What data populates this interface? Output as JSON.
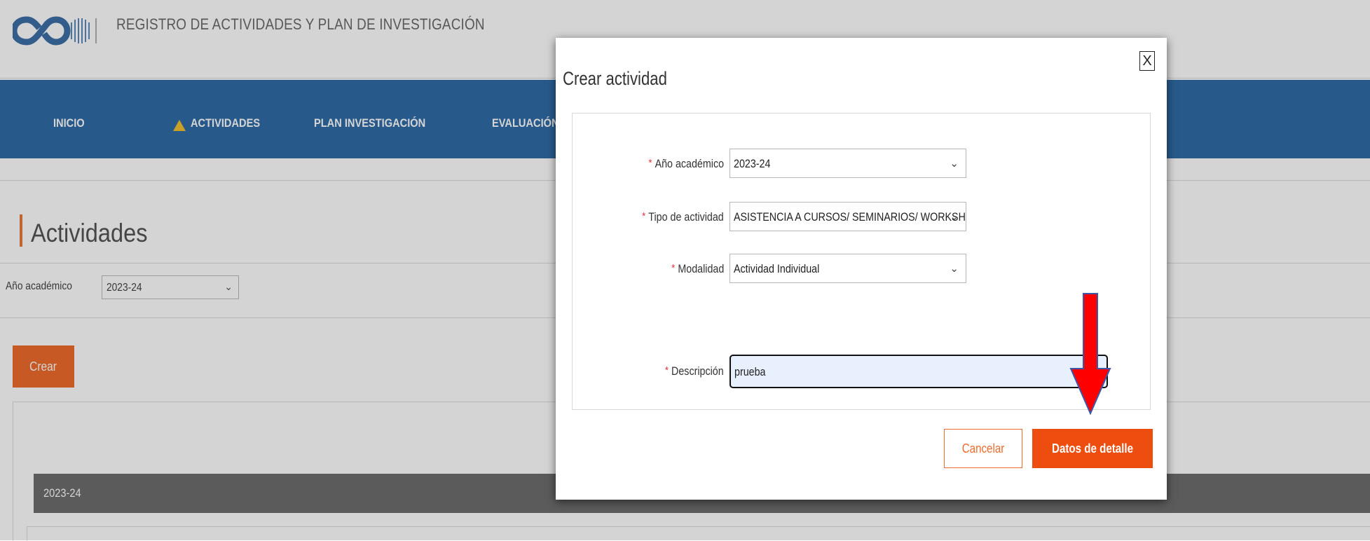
{
  "app": {
    "title": "REGISTRO DE ACTIVIDADES Y PLAN DE INVESTIGACIÓN",
    "nav": [
      {
        "label": "INICIO"
      },
      {
        "label": "ACTIVIDADES",
        "icon": "warning-icon"
      },
      {
        "label": "PLAN INVESTIGACIÓN"
      },
      {
        "label": "EVALUACIÓN"
      }
    ]
  },
  "page": {
    "heading": "Actividades",
    "filter_label": "Año académico",
    "filter_value": "2023-24",
    "create_button": "Crear",
    "year_section": "2023-24"
  },
  "modal": {
    "title": "Crear actividad",
    "close_label": "X",
    "fields": {
      "year": {
        "label": "Año académico",
        "value": "2023-24"
      },
      "type": {
        "label": "Tipo de actividad",
        "value": "ASISTENCIA A CURSOS/ SEMINARIOS/ WORKSHOPS"
      },
      "mode": {
        "label": "Modalidad",
        "value": "Actividad Individual"
      },
      "description": {
        "label": "Descripción",
        "value": "prueba"
      }
    },
    "required_mark": "*",
    "cancel_button": "Cancelar",
    "details_button": "Datos de detalle"
  },
  "colors": {
    "nav_bar": "#2f6da8",
    "accent_orange": "#ee6b2c",
    "primary_button": "#ee4d10",
    "annotation_arrow": "#ff0000"
  }
}
